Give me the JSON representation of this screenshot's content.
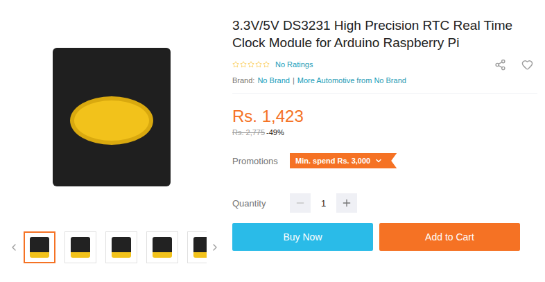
{
  "product": {
    "title": "3.3V/5V DS3231 High Precision RTC Real Time Clock Module for Arduino Raspberry Pi",
    "rating": {
      "stars": 0,
      "out_of": 5,
      "label": "No Ratings"
    },
    "brand": {
      "label": "Brand:",
      "name": "No Brand",
      "separator": "|",
      "more": "More Automotive from No Brand"
    },
    "price": {
      "current": "Rs. 1,423",
      "original": "Rs. 2,775",
      "discount": "-49%"
    },
    "promotions": {
      "label": "Promotions",
      "tag": "Min. spend Rs. 3,000",
      "expanded": false
    },
    "quantity": {
      "label": "Quantity",
      "value": "1",
      "decrease_disabled": true
    },
    "buttons": [
      {
        "label": "Buy Now",
        "kind": "buy"
      },
      {
        "label": "Add to Cart",
        "kind": "cart"
      }
    ]
  },
  "gallery": {
    "thumbnails": [
      {
        "selected": true
      },
      {
        "selected": false
      },
      {
        "selected": false
      },
      {
        "selected": false
      },
      {
        "selected": false
      }
    ]
  }
}
